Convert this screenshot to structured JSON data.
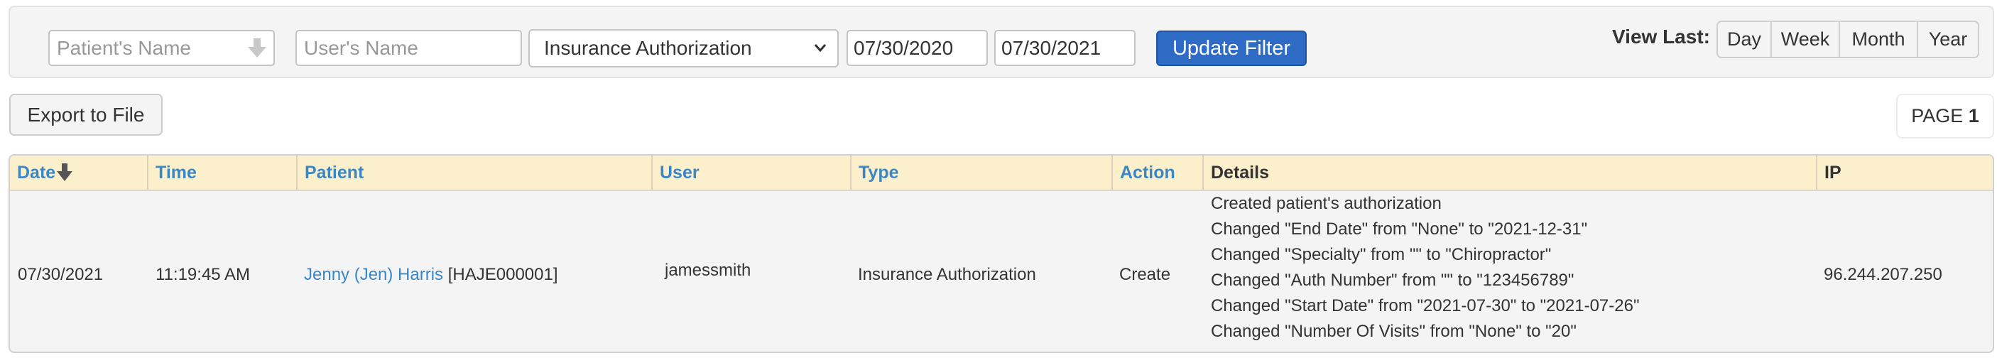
{
  "filters": {
    "patient_placeholder": "Patient's Name",
    "patient_value": "",
    "user_placeholder": "User's Name",
    "user_value": "",
    "type_selected": "Insurance Authorization",
    "date_from": "07/30/2020",
    "date_to": "07/30/2021",
    "update_button": "Update Filter",
    "view_last_label": "View Last:",
    "view_last_options": [
      "Day",
      "Week",
      "Month",
      "Year"
    ]
  },
  "toolbar": {
    "export_button": "Export to File",
    "page_label": "PAGE",
    "page_number": "1"
  },
  "table": {
    "columns": [
      {
        "label": "Date",
        "sortable": true,
        "sorted": "desc"
      },
      {
        "label": "Time",
        "sortable": true
      },
      {
        "label": "Patient",
        "sortable": true
      },
      {
        "label": "User",
        "sortable": true
      },
      {
        "label": "Type",
        "sortable": true
      },
      {
        "label": "Action",
        "sortable": true
      },
      {
        "label": "Details",
        "sortable": false
      },
      {
        "label": "IP",
        "sortable": false
      }
    ],
    "rows": [
      {
        "date": "07/30/2021",
        "time": "11:19:45 AM",
        "patient_name": "Jenny (Jen) Harris",
        "patient_id": "[HAJE000001]",
        "user": "jamessmith",
        "type": "Insurance Authorization",
        "action": "Create",
        "details": [
          "Created patient's authorization",
          "Changed \"End Date\" from \"None\" to \"2021-12-31\"",
          "Changed \"Specialty\" from \"\" to \"Chiropractor\"",
          "Changed \"Auth Number\" from \"\" to \"123456789\"",
          "Changed \"Start Date\" from \"2021-07-30\" to \"2021-07-26\"",
          "Changed \"Number Of Visits\" from \"None\" to \"20\""
        ],
        "ip": "96.244.207.250"
      }
    ]
  },
  "colors": {
    "link": "#3a87c8",
    "primary_button": "#2d6bc4",
    "header_bg": "#fcefcc",
    "panel_bg": "#f4f4f4"
  }
}
